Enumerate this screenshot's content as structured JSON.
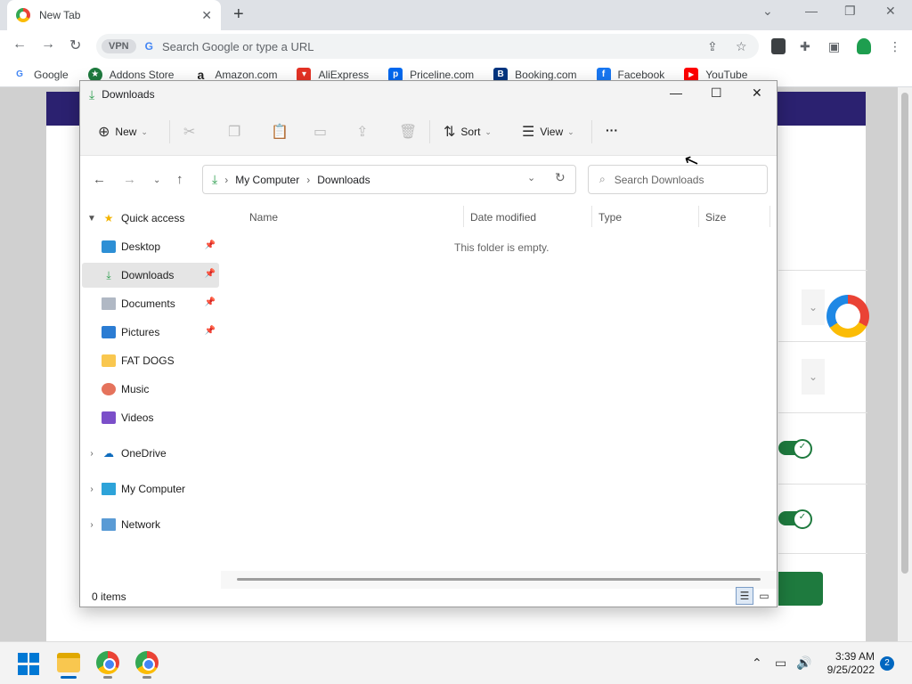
{
  "browser": {
    "tab_title": "New Tab",
    "vpn_label": "VPN",
    "google_g": "G",
    "omnibox_placeholder": "Search Google or type a URL",
    "bookmarks": [
      {
        "label": "Google",
        "icon": "G",
        "color": "#4285f4"
      },
      {
        "label": "Addons Store",
        "icon": "★",
        "color": "#1e7a3e"
      },
      {
        "label": "Amazon.com",
        "icon": "a",
        "color": "#222222"
      },
      {
        "label": "AliExpress",
        "icon": "▾",
        "color": "#e43225"
      },
      {
        "label": "Priceline.com",
        "icon": "p",
        "color": "#0068ef"
      },
      {
        "label": "Booking.com",
        "icon": "B",
        "color": "#003580"
      },
      {
        "label": "Facebook",
        "icon": "f",
        "color": "#1877f2"
      },
      {
        "label": "YouTube",
        "icon": "▶",
        "color": "#ff0000"
      }
    ]
  },
  "explorer": {
    "title": "Downloads",
    "commands": {
      "new": "New",
      "sort": "Sort",
      "view": "View",
      "more": "···"
    },
    "breadcrumb": [
      "My Computer",
      "Downloads"
    ],
    "search_placeholder": "Search Downloads",
    "nav": {
      "quick_access": "Quick access",
      "items": [
        "Desktop",
        "Downloads",
        "Documents",
        "Pictures",
        "FAT DOGS",
        "Music",
        "Videos"
      ],
      "onedrive": "OneDrive",
      "my_computer": "My Computer",
      "network": "Network"
    },
    "columns": [
      "Name",
      "Date modified",
      "Type",
      "Size"
    ],
    "empty_message": "This folder is empty.",
    "status": "0 items"
  },
  "taskbar": {
    "time": "3:39 AM",
    "date": "9/25/2022",
    "notifications": "2"
  }
}
